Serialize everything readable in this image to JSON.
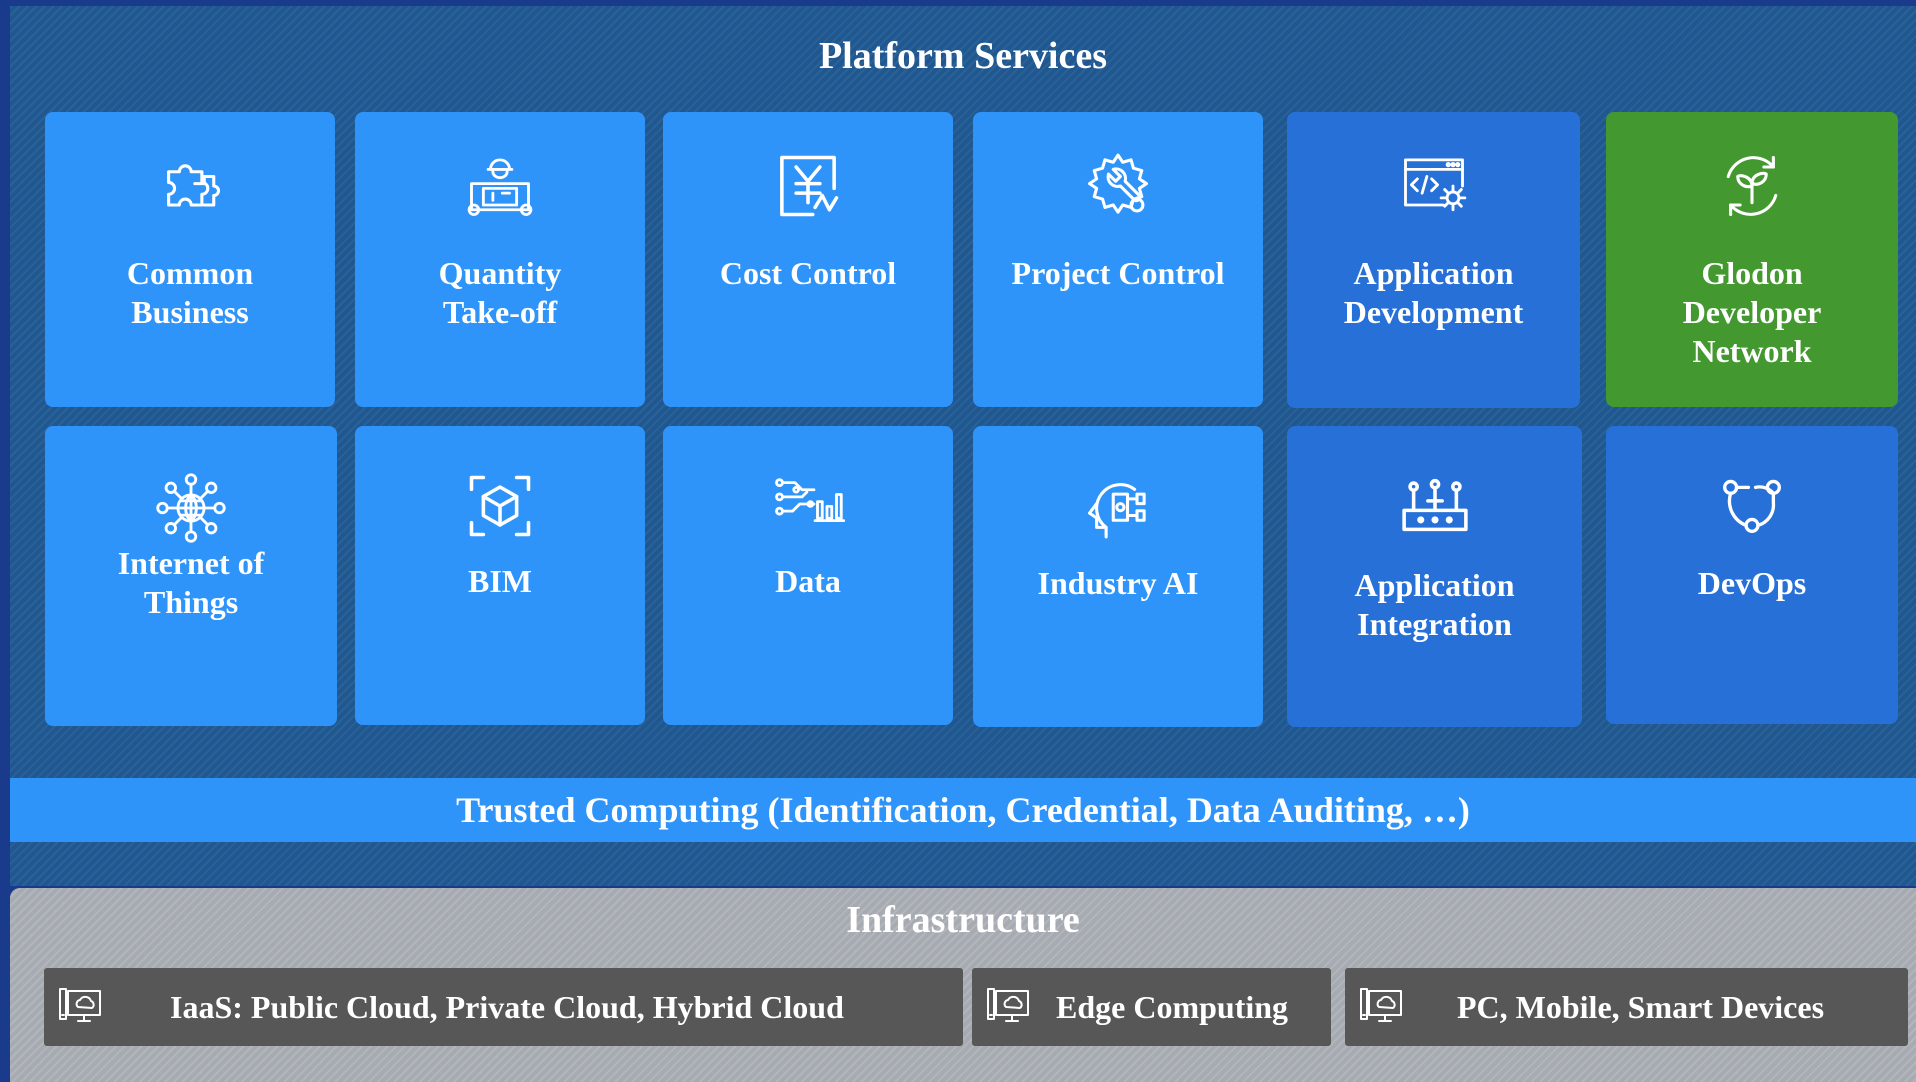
{
  "platform": {
    "title": "Platform Services",
    "tiles": [
      {
        "label": "Common\nBusiness",
        "icon": "puzzle-icon",
        "color": "#2f94fa"
      },
      {
        "label": "Quantity\nTake-off",
        "icon": "engineer-blueprint-icon",
        "color": "#2f94fa"
      },
      {
        "label": "Cost Control",
        "icon": "yen-document-icon",
        "color": "#2f94fa"
      },
      {
        "label": "Project Control",
        "icon": "gear-wrench-icon",
        "color": "#2f94fa"
      },
      {
        "label": "Application\nDevelopment",
        "icon": "code-window-gear-icon",
        "color": "#2670d8"
      },
      {
        "label": "Glodon\nDeveloper\nNetwork",
        "icon": "sprout-cycle-icon",
        "color": "#43992f"
      },
      {
        "label": "Internet of\nThings",
        "icon": "globe-network-icon",
        "color": "#2f94fa"
      },
      {
        "label": "BIM",
        "icon": "cube-frame-icon",
        "color": "#2f94fa"
      },
      {
        "label": "Data",
        "icon": "data-circuit-chart-icon",
        "color": "#2f94fa"
      },
      {
        "label": "Industry AI",
        "icon": "ai-head-icon",
        "color": "#2f94fa"
      },
      {
        "label": "Application\nIntegration",
        "icon": "router-icon",
        "color": "#2670d8"
      },
      {
        "label": "DevOps",
        "icon": "devops-cycle-icon",
        "color": "#2670d8"
      }
    ]
  },
  "trusted": {
    "label": "Trusted Computing (Identification, Credential, Data Auditing, …)"
  },
  "infrastructure": {
    "title": "Infrastructure",
    "boxes": [
      {
        "label": "IaaS: Public Cloud, Private Cloud, Hybrid Cloud",
        "icon": "cloud-monitor-icon"
      },
      {
        "label": "Edge Computing",
        "icon": "cloud-monitor-icon"
      },
      {
        "label": "PC, Mobile, Smart Devices",
        "icon": "cloud-monitor-icon"
      }
    ]
  }
}
